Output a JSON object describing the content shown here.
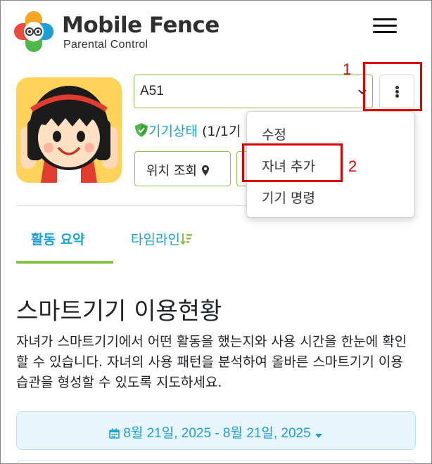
{
  "app": {
    "brand_name": "Mobile Fence",
    "brand_subtitle": "Parental Control",
    "menu_icon": "hamburger-menu-icon"
  },
  "profile": {
    "avatar_icon": "child-avatar-icon",
    "device_selected": "A51",
    "more_icon": "kebab-menu-icon",
    "status_link": "기기상태",
    "status_count": "(1/1기",
    "status_icon": "shield-check-icon",
    "locate_button": "위치 조회",
    "locate_icon": "map-marker-icon"
  },
  "dropdown": {
    "items": [
      "수정",
      "자녀 추가",
      "기기 명령"
    ]
  },
  "tabs": {
    "summary": "활동 요약",
    "timeline": "타임라인",
    "timeline_icon": "sort-descending-icon"
  },
  "main": {
    "title": "스마트기기 이용현황",
    "description": "자녀가 스마트기기에서 어떤 활동을 했는지와 사용 시간을 한눈에 확인할 수 있습니다. 자녀의 사용 패턴을 분석하여 올바른 스마트기기 이용 습관을 형성할 수 있도록 지도하세요.",
    "date_range": "8월 21일, 2025 - 8월 21일, 2025",
    "calendar_icon": "calendar-icon",
    "caret_icon": "caret-down-icon"
  },
  "annotations": {
    "one": "1",
    "two": "2",
    "color": "#e00000"
  },
  "colors": {
    "accent_blue": "#1aa1d8",
    "accent_green": "#8bc34a"
  }
}
